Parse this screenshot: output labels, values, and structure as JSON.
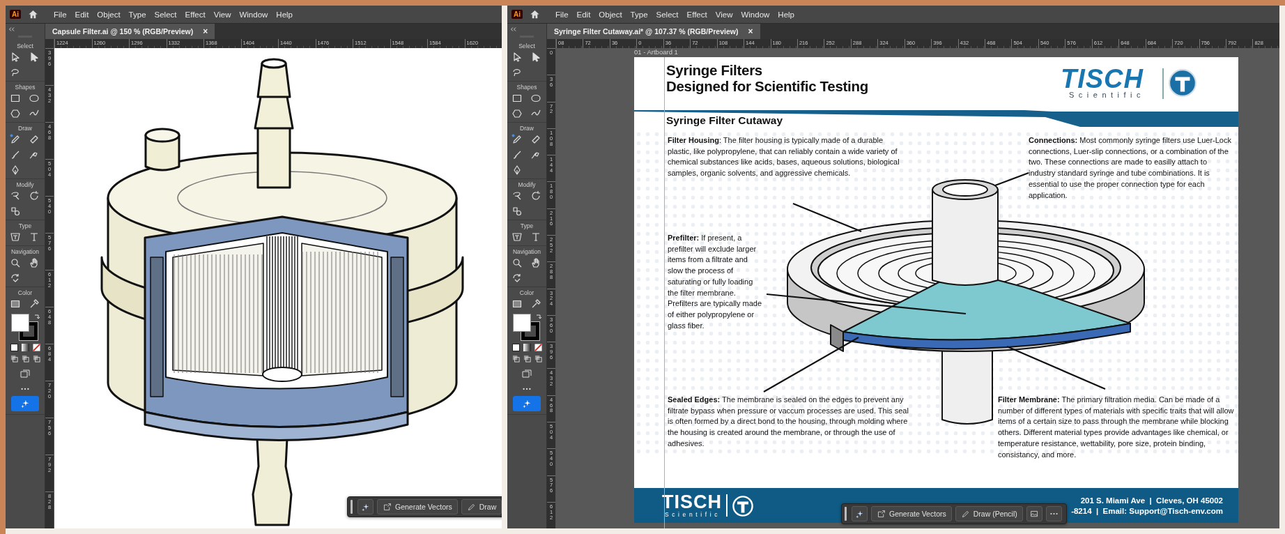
{
  "windows": [
    {
      "app_icon": "Ai",
      "menu": [
        "File",
        "Edit",
        "Object",
        "Type",
        "Select",
        "Effect",
        "View",
        "Window",
        "Help"
      ],
      "tab": {
        "title": "Capsule Filter.ai @ 150 % (RGB/Preview)",
        "close": "×",
        "selected": true
      },
      "ruler_h": [
        "1224",
        "1260",
        "1296",
        "1332",
        "1368",
        "1404",
        "1440",
        "1476",
        "1512",
        "1548",
        "1584",
        "1620"
      ],
      "ruler_v": [
        "396",
        "432",
        "468",
        "504",
        "540",
        "576",
        "612",
        "648",
        "684",
        "720",
        "756",
        "792",
        "828"
      ],
      "toolbar": {
        "sections": [
          "Select",
          "Shapes",
          "Draw",
          "Modify",
          "Type",
          "Navigation",
          "Color"
        ]
      },
      "document": {
        "kind": "capsule"
      },
      "context_bar": [
        {
          "kind": "ai"
        },
        {
          "kind": "generate",
          "label": "Generate Vectors"
        },
        {
          "kind": "draw",
          "label": "Draw"
        }
      ]
    },
    {
      "app_icon": "Ai",
      "menu": [
        "File",
        "Edit",
        "Object",
        "Type",
        "Select",
        "Effect",
        "View",
        "Window",
        "Help"
      ],
      "tab": {
        "title": "Syringe Filter Cutaway.ai* @ 107.37 % (RGB/Preview)",
        "close": "×",
        "selected": true
      },
      "ruler_h": [
        "08",
        "72",
        "36",
        "0",
        "36",
        "72",
        "108",
        "144",
        "180",
        "216",
        "252",
        "288",
        "324",
        "360",
        "396",
        "432",
        "468",
        "504",
        "540",
        "576",
        "612",
        "648",
        "684",
        "720",
        "756",
        "792",
        "828"
      ],
      "ruler_v": [
        "0",
        "36",
        "72",
        "108",
        "144",
        "180",
        "216",
        "252",
        "288",
        "324",
        "360",
        "396",
        "432",
        "468",
        "504",
        "540",
        "576",
        "612"
      ],
      "toolbar": {
        "sections": [
          "Select",
          "Shapes",
          "Draw",
          "Modify",
          "Type",
          "Navigation",
          "Color"
        ]
      },
      "document": {
        "kind": "sheet",
        "artboard_label": "01 - Artboard 1",
        "title": [
          "Syringe Filters",
          "Designed for Scientific Testing"
        ],
        "logo": {
          "wordmark": "TISCH",
          "tagline": "Scientific"
        },
        "subtitle": "Syringe Filter Cutaway",
        "callouts": [
          {
            "text": "**Filter Housing**: The filter housing is typically made of a durable plastic, like polypropylene, that can reliably contain a wide variety of chemical substances like acids, bases, aqueous solutions, biological samples, organic solvents, and aggressive chemicals."
          },
          {
            "text": "**Connections:** Most commonly syringe filters use Luer-Lock connections, Luer-slip connections, or a combination of the two. These connections are made to easilly attach to industry standard syringe and tube combinations. It is essential to use the proper connection type for each application."
          },
          {
            "text": "**Prefilter:** If present, a prefilter will exclude larger items from a filtrate and slow the process of saturating or fully loading the filter membrane. Prefilters are typically made of either polypropylene or glass fiber."
          },
          {
            "text": "**Sealed Edges:** The membrane is sealed on the edges to prevent any filtrate bypass when pressure or vaccum processes are used. This seal is often formed by a direct bond to the housing, through molding where the housing is created around the membrane, or through the use of adhesives."
          },
          {
            "text": "**Filter Membrane:** The primary filtration media. Can be made of a number of different types of materials with specific traits that will allow items of a certain size to pass through the membrane while blocking others. Different material types provide advantages like chemical, or temperature resistance, wettability, pore size, protein binding, consistancy, and more."
          }
        ],
        "footer": {
          "logo": {
            "wordmark": "TISCH",
            "tagline": "Scientific"
          },
          "address": "201 S. Miami Ave  |  Cleves, OH 45002",
          "contact": "-8214  |  Email: Support@Tisch-env.com"
        }
      },
      "context_bar": [
        {
          "kind": "ai"
        },
        {
          "kind": "generate",
          "label": "Generate Vectors"
        },
        {
          "kind": "draw",
          "label": "Draw (Pencil)"
        },
        {
          "kind": "image"
        },
        {
          "kind": "more"
        }
      ]
    }
  ]
}
